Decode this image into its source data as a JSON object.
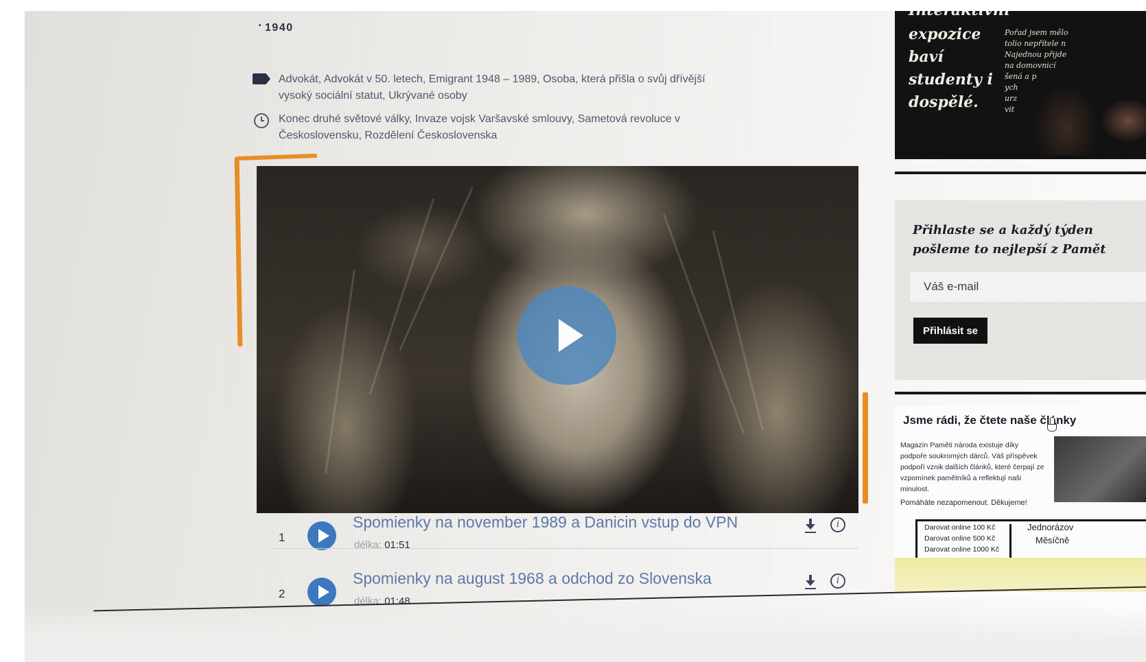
{
  "article": {
    "year": "1940",
    "tags_text": "Advokát, Advokát v 50. letech, Emigrant 1948 – 1989, Osoba, která přišla o svůj dřívější vysoký sociální statut, Ukrývané osoby",
    "events_text": "Konec druhé světové války, Invaze vojsk Varšavské smlouvy, Sametová revoluce v Československu, Rozdělení Československa",
    "icons": {
      "tags": "tag-icon",
      "events": "clock-icon",
      "play": "play-icon",
      "download": "download-icon",
      "info": "info-icon"
    },
    "tracks": [
      {
        "number": "1",
        "title": "Spomienky na november 1989 a Danicin vstup do VPN",
        "duration_label": "délka:",
        "duration": "01:51"
      },
      {
        "number": "2",
        "title": "Spomienky na august 1968 a odchod zo Slovenska",
        "duration_label": "délka:",
        "duration": "01:48"
      }
    ]
  },
  "sidebar": {
    "promo": {
      "headline_top": "Interaktivní",
      "headline": "expozice baví studenty i dospělé.",
      "quote": "Pořad jsem mělo\ntolio nepřítele n\nNajednou přijde\nna domovnicí\nšená a p\nych\nurz\nvit"
    },
    "newsletter": {
      "title": "Přihlaste se a každý týden\npošleme to nejlepší z Pamět",
      "email_placeholder": "Váš e-mail",
      "submit_label": "Přihlásit se"
    },
    "donate": {
      "title": "Jsme rádi, že čtete naše články",
      "text": "Magazín Paměti národa existuje díky podpoře soukromých dárců. Váš příspěvek podpoří vznik dalších článků, které čerpají ze vzpomínek pamětníků a reflektují naši minulost.",
      "thanks": "Pomáháte nezapomenout. Děkujeme!",
      "options": [
        "Darovat online 100 Kč",
        "Darovat online 500 Kč",
        "Darovat online 1000 Kč"
      ],
      "frequency": [
        "Jednorázov",
        "Měsíčně"
      ]
    }
  },
  "colors": {
    "accent_orange": "#ea8f24",
    "play_blue": "#3d79c2",
    "track_title": "#5d7aa9"
  }
}
